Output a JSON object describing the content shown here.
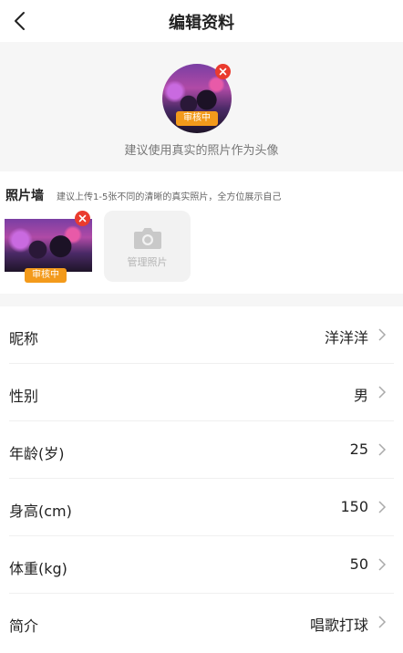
{
  "nav": {
    "title": "编辑资料"
  },
  "avatar": {
    "status": "审核中",
    "tip": "建议使用真实的照片作为头像"
  },
  "photo_wall": {
    "title": "照片墙",
    "tip": "建议上传1-5张不同的清晰的真实照片，全方位展示自己",
    "photos": [
      {
        "status": "审核中"
      }
    ],
    "add_label": "管理照片"
  },
  "fields": [
    {
      "label": "昵称",
      "value": "洋洋洋"
    },
    {
      "label": "性别",
      "value": "男"
    },
    {
      "label": "年龄(岁)",
      "value": "25"
    },
    {
      "label": "身高(cm)",
      "value": "150"
    },
    {
      "label": "体重(kg)",
      "value": "50"
    },
    {
      "label": "简介",
      "value": "唱歌打球"
    }
  ],
  "colors": {
    "accent": "#f39a1b",
    "delete": "#ea3b2e",
    "section_bg": "#f6f6f6"
  },
  "icons": [
    "back-icon",
    "delete-icon",
    "camera-icon",
    "chevron-right-icon"
  ]
}
